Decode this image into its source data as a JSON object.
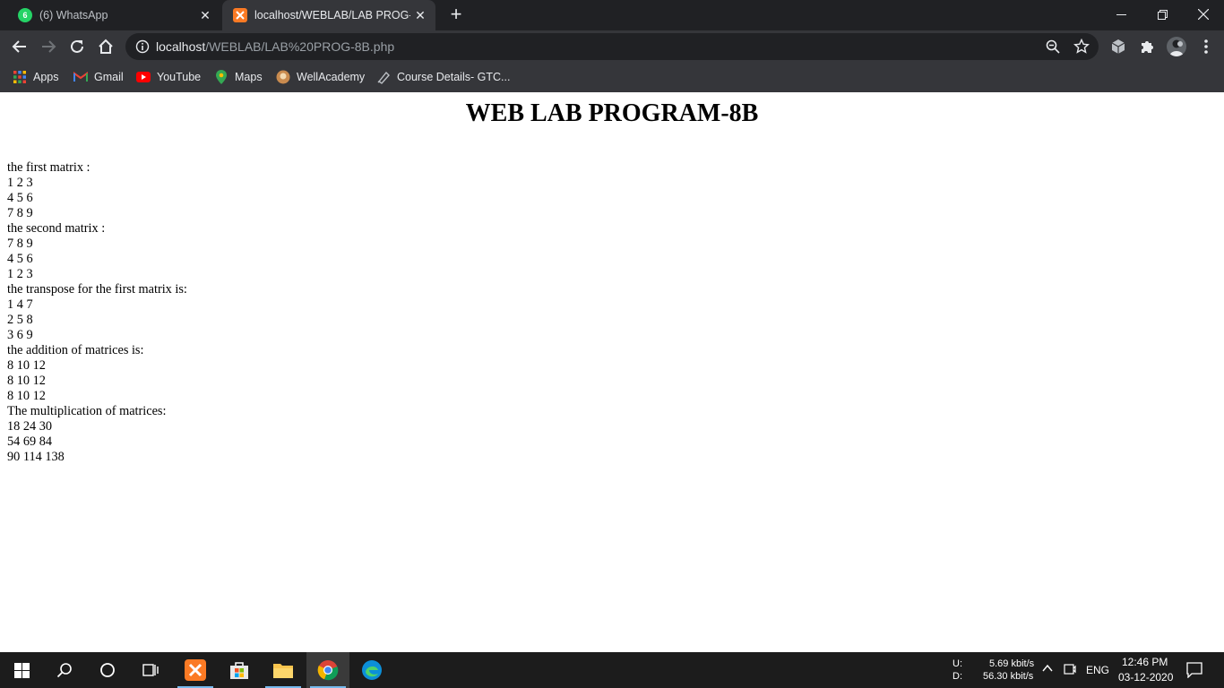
{
  "browser": {
    "tabs": [
      {
        "title": "(6) WhatsApp",
        "badge": "6",
        "favicon": "whatsapp-icon",
        "active": false
      },
      {
        "title": "localhost/WEBLAB/LAB PROG-8B",
        "favicon": "xampp-icon",
        "active": true
      }
    ],
    "url_host": "localhost",
    "url_path": "/WEBLAB/LAB%20PROG-8B.php",
    "bookmarks": [
      {
        "label": "Apps",
        "icon": "apps-grid-icon"
      },
      {
        "label": "Gmail",
        "icon": "gmail-icon"
      },
      {
        "label": "YouTube",
        "icon": "youtube-icon"
      },
      {
        "label": "Maps",
        "icon": "maps-icon"
      },
      {
        "label": "WellAcademy",
        "icon": "wellacademy-icon"
      },
      {
        "label": "Course Details- GTC...",
        "icon": "course-icon"
      }
    ]
  },
  "page": {
    "heading": "WEB LAB PROGRAM-8B",
    "lines": [
      "the first matrix :",
      "1 2 3",
      "4 5 6",
      "7 8 9",
      "the second matrix :",
      "7 8 9",
      "4 5 6",
      "1 2 3",
      "the transpose for the first matrix is:",
      "1 4 7",
      "2 5 8",
      "3 6 9",
      "the addition of matrices is:",
      "8 10 12",
      "8 10 12",
      "8 10 12",
      "The multiplication of matrices:",
      "18 24 30",
      "54 69 84",
      "90 114 138"
    ]
  },
  "taskbar": {
    "network_upload_label": "U:",
    "network_upload_value": "5.69 kbit/s",
    "network_download_label": "D:",
    "network_download_value": "56.30 kbit/s",
    "language": "ENG",
    "time": "12:46 PM",
    "date": "03-12-2020"
  },
  "colors": {
    "chrome_dark": "#202124",
    "chrome_toolbar": "#35363a",
    "taskbar": "#1c1c1c",
    "accent": "#76b9ed"
  }
}
